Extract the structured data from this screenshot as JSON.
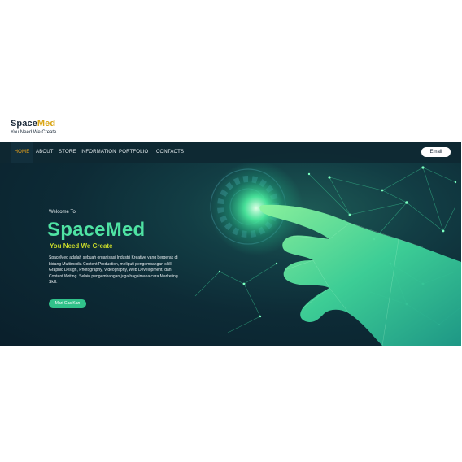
{
  "logo": {
    "name_part1": "Space",
    "name_part2": "Med",
    "tagline": "You Need We Create"
  },
  "nav": {
    "items": [
      {
        "label": "HOME",
        "active": true
      },
      {
        "label": "ABOUT"
      },
      {
        "label": "STORE"
      },
      {
        "label": "INFORMATION"
      },
      {
        "label": "PORTFOLIO"
      },
      {
        "label": "CONTACTS"
      }
    ],
    "email_button": "Email"
  },
  "hero": {
    "welcome": "Welcome To",
    "title_part1": "Space",
    "title_part2": "Med",
    "subtitle": "You Need We Create",
    "description": "SpaceMed adalah sebuah organisasi Industri Kreative yang bergerak di bidang Multimedia Content Production, meliputi pengembangan skill Graphic Design, Photography, Videography, Web Development, dan Content Writing. Selain pengembangan juga bagaimana cara Marketing Skill.",
    "cta": "Mari Gas Kan"
  },
  "colors": {
    "accent": "#e8a21a",
    "brand_green": "#4fe3a3",
    "subtitle_lime": "#c7d82a",
    "hero_bg": "#0d2b36"
  }
}
